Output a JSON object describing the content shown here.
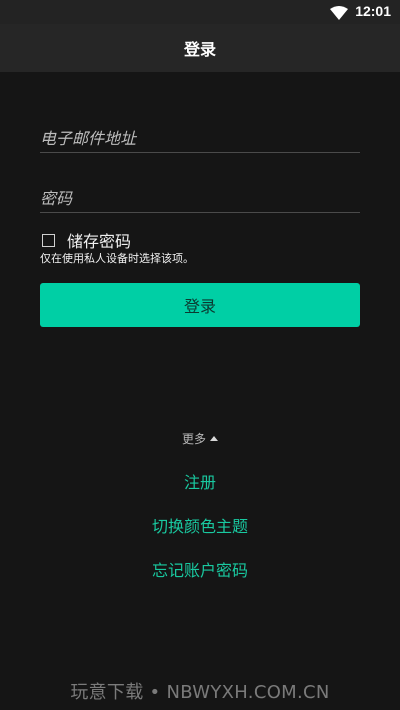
{
  "status_bar": {
    "time": "12:01",
    "wifi_icon": "wifi-icon"
  },
  "app_bar": {
    "title": "登录"
  },
  "form": {
    "email_placeholder": "电子邮件地址",
    "password_placeholder": "密码",
    "remember_label": "储存密码",
    "remember_checked": false,
    "remember_hint": "仅在使用私人设备时选择该项。",
    "login_button": "登录"
  },
  "more": {
    "label": "更多"
  },
  "links": {
    "register": "注册",
    "switch_theme": "切换颜色主题",
    "forgot_password": "忘记账户密码"
  },
  "watermark": "玩意下载 • NBWYXH.COM.CN",
  "colors": {
    "accent": "#00cfa5",
    "link": "#19c9a0",
    "background": "#151515"
  }
}
